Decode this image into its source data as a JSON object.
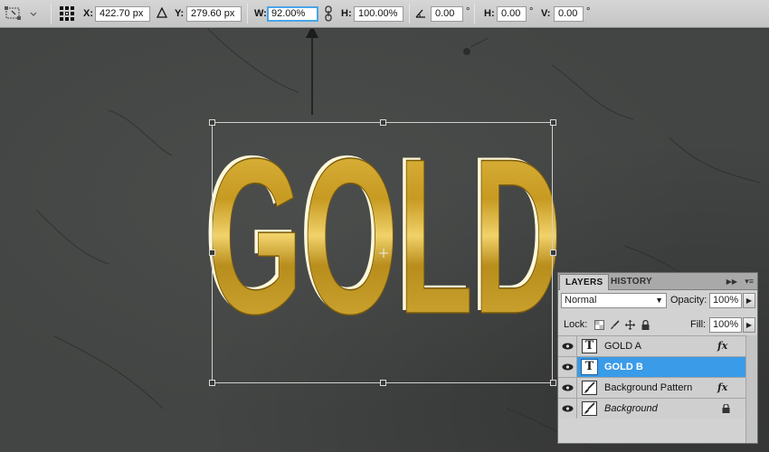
{
  "options_bar": {
    "x_label": "X:",
    "x_value": "422.70 px",
    "y_label": "Y:",
    "y_value": "279.60 px",
    "w_label": "W:",
    "w_value": "92.00%",
    "h_label": "H:",
    "h_value": "100.00%",
    "rotate_value": "0.00",
    "hskew_label": "H:",
    "hskew_value": "0.00",
    "vskew_label": "V:",
    "vskew_value": "0.00",
    "degree_symbol": "°"
  },
  "canvas": {
    "text": "GOLD",
    "background_color": "#434544",
    "gold_light": "#f3d36a",
    "gold_dark": "#8a6a12"
  },
  "layers_panel": {
    "tabs": [
      {
        "label": "LAYERS",
        "active": true
      },
      {
        "label": "HISTORY",
        "active": false
      }
    ],
    "blend_mode": "Normal",
    "opacity_label": "Opacity:",
    "opacity_value": "100%",
    "lock_label": "Lock:",
    "fill_label": "Fill:",
    "fill_value": "100%",
    "layers": [
      {
        "name": "GOLD A",
        "kind": "text",
        "fx": "fx",
        "selected": false
      },
      {
        "name": "GOLD B",
        "kind": "text",
        "fx": "",
        "selected": true
      },
      {
        "name": "Background Pattern",
        "kind": "brush",
        "fx": "fx",
        "selected": false
      },
      {
        "name": "Background",
        "kind": "brush",
        "fx": "",
        "selected": false,
        "locked": true
      }
    ],
    "selected_color": "#3a9be8"
  }
}
